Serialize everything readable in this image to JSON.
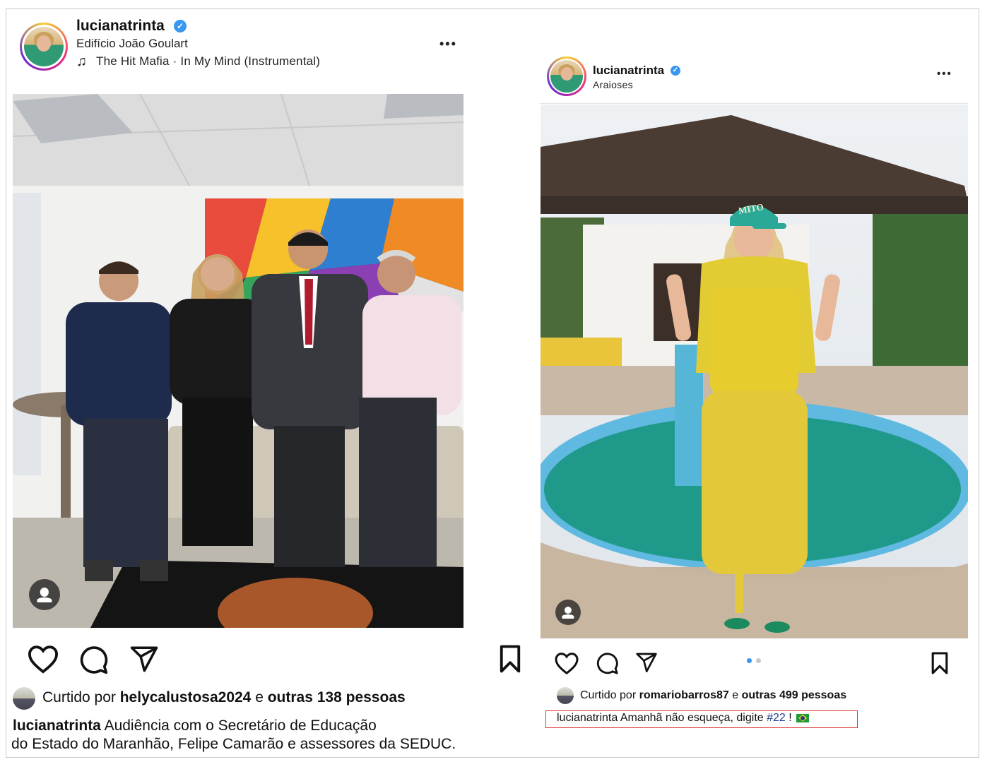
{
  "left_post": {
    "username": "lucianatrinta",
    "location": "Edifício João Goulart",
    "music": "The Hit Mafia · In My Mind (Instrumental)",
    "more_label": "•••",
    "liked_by_prefix": "Curtido por",
    "liked_by_user": "helycalustosa2024",
    "liked_by_mid": "e",
    "liked_by_others": "outras 138 pessoas",
    "caption_user": "lucianatrinta",
    "caption_text_line1": "Audiência com o Secretário de Educação",
    "caption_text_line2": "do Estado do Maranhão, Felipe Camarão e assessores da SEDUC."
  },
  "right_post": {
    "username": "lucianatrinta",
    "location": "Araioses",
    "more_label": "•••",
    "cap_text": "MITO",
    "liked_by_prefix": "Curtido por",
    "liked_by_user": "romariobarros87",
    "liked_by_mid": "e",
    "liked_by_others": "outras 499 pessoas",
    "caption_user": "lucianatrinta",
    "caption_text": "Amanhã não esqueça, digite",
    "caption_hashtag": "#22",
    "caption_end": "!",
    "carousel_count": 2,
    "carousel_active": 1
  },
  "colors": {
    "verified": "#3897f0",
    "carousel_active": "#3897f0",
    "carousel_inactive": "#c8c8c8",
    "highlight_box": "#dd3333"
  },
  "icons": [
    "verified-badge-icon",
    "music-note-icon",
    "more-options-icon",
    "heart-icon",
    "comment-icon",
    "share-icon",
    "bookmark-icon",
    "user-tag-icon",
    "brazil-flag-icon"
  ]
}
